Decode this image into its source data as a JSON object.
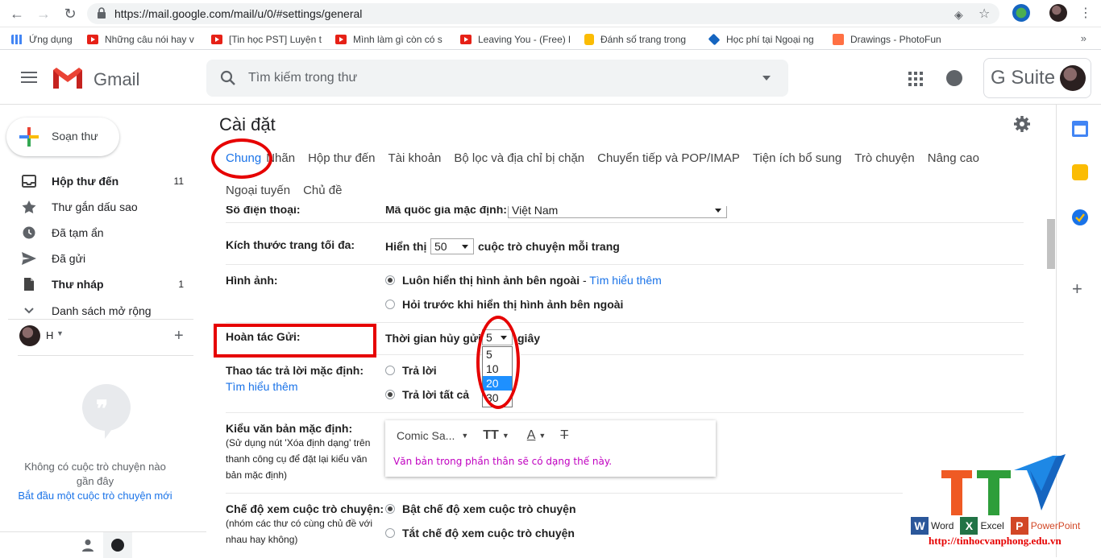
{
  "browser": {
    "url": "https://mail.google.com/mail/u/0/#settings/general",
    "bookmarks": [
      "Ứng dụng",
      "Những câu nói hay v",
      "[Tin học PST] Luyện t",
      "Mình làm gì còn có s",
      "Leaving You - (Free) l",
      "Đánh số trang trong",
      "Học phí tại Ngoại ng",
      "Drawings - PhotoFun"
    ],
    "more": "»"
  },
  "header": {
    "app_name": "Gmail",
    "search_placeholder": "Tìm kiếm trong thư",
    "gsuite": "G Suite"
  },
  "nav": {
    "compose": "Soạn thư",
    "items": [
      {
        "label": "Hộp thư đến",
        "count": "11"
      },
      {
        "label": "Thư gắn dấu sao",
        "count": ""
      },
      {
        "label": "Đã tạm ẩn",
        "count": ""
      },
      {
        "label": "Đã gửi",
        "count": ""
      },
      {
        "label": "Thư nháp",
        "count": "1"
      },
      {
        "label": "Danh sách mở rộng",
        "count": ""
      }
    ]
  },
  "hangouts": {
    "user": "H",
    "empty_text": "Không có cuộc trò chuyện nào gần đây",
    "start_link": "Bắt đầu một cuộc trò chuyện mới"
  },
  "settings": {
    "title": "Cài đặt",
    "tabs": [
      "Chung",
      "Nhãn",
      "Hộp thư đến",
      "Tài khoản",
      "Bộ lọc và địa chỉ bị chặn",
      "Chuyển tiếp và POP/IMAP",
      "Tiện ích bổ sung",
      "Trò chuyện",
      "Nâng cao"
    ],
    "tabs2": [
      "Ngoại tuyến",
      "Chủ đề"
    ],
    "phone": {
      "label": "Số điện thoại:",
      "value": "Mã quốc gia mặc định:",
      "select": "Việt Nam"
    },
    "page_size": {
      "label": "Kích thước trang tối đa:",
      "prefix": "Hiển thị",
      "select": "50",
      "suffix": "cuộc trò chuyện mỗi trang"
    },
    "images": {
      "label": "Hình ảnh:",
      "opt1": "Luôn hiển thị hình ảnh bên ngoài",
      "opt1_sep": " - ",
      "opt1_link": "Tìm hiểu thêm",
      "opt2": "Hỏi trước khi hiển thị hình ảnh bên ngoài"
    },
    "undo_send": {
      "label": "Hoàn tác Gửi:",
      "prefix": "Thời gian hủy gửi:",
      "select": "5",
      "suffix": "giây",
      "options": [
        "5",
        "10",
        "20",
        "30"
      ],
      "highlighted": "20"
    },
    "reply": {
      "label": "Thao tác trả lời mặc định:",
      "link": "Tìm hiểu thêm",
      "opt1": "Trả lời",
      "opt2": "Trả lời tất cả"
    },
    "text_style": {
      "label": "Kiểu văn bản mặc định:",
      "note": "(Sử dụng nút 'Xóa định dạng' trên thanh công cụ để đặt lại kiểu văn bản mặc định)",
      "font": "Comic Sa...",
      "sample": "Văn bản trong phần thân sẽ có dạng thế này."
    },
    "conversation": {
      "label": "Chế độ xem cuộc trò chuyện:",
      "note": "(nhóm các thư có cùng chủ đề với nhau hay không)",
      "opt1": "Bật chế độ xem cuộc trò chuyện",
      "opt2": "Tắt chế độ xem cuộc trò chuyện"
    }
  },
  "watermark": {
    "word": "Word",
    "excel": "Excel",
    "powerpoint": "PowerPoint",
    "url": "http://tinhocvanphong.edu.vn"
  },
  "colors": {
    "accent": "#1a73e8",
    "annotation": "#e60000"
  }
}
